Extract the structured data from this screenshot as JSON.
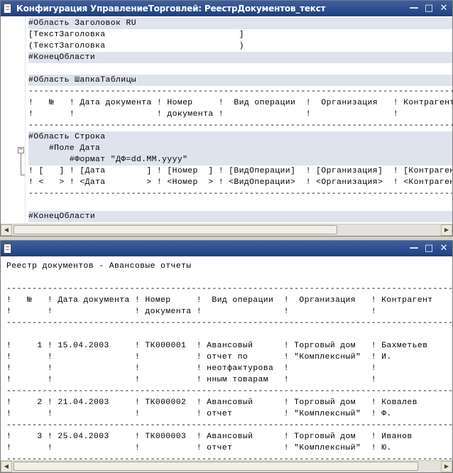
{
  "window1": {
    "title": "Конфигурация УправлениеТорговлей: РеестрДокументов_текст",
    "buttons": {
      "minimize": "—",
      "maximize": "□",
      "close": "✕"
    }
  },
  "window2": {
    "buttons": {
      "minimize": "—",
      "maximize": "□",
      "close": "✕"
    }
  },
  "template_lines": [
    {
      "text": "#Область Заголовок RU",
      "hl": true
    },
    {
      "text": "[ТекстЗаголовка                          ]",
      "hl": false
    },
    {
      "text": "(ТекстЗаголовка                          )",
      "hl": false
    },
    {
      "text": "#КонецОбласти",
      "hl": true
    },
    {
      "text": "",
      "hl": false
    },
    {
      "text": "#Область ШапкаТаблицы",
      "hl": true
    },
    {
      "text": "------------------------------------------------------------------------------------------",
      "hl": false
    },
    {
      "text": "!   №   ! Дата документа ! Номер     !  Вид операции  !  Организация   ! Контрагент",
      "hl": false
    },
    {
      "text": "!       !                ! документа !                !                !",
      "hl": false
    },
    {
      "text": "------------------------------------------------------------------------------------------",
      "hl": false
    },
    {
      "text": "#Область Строка",
      "hl": true
    },
    {
      "text": "    #Поле Дата",
      "hl": true
    },
    {
      "text": "        #Формат \"ДФ=dd.MM.yyyy\"",
      "hl": true
    },
    {
      "text": "! [   ] ! [Дата        ] ! [Номер  ] ! [ВидОперации]  ! [Организация]  ! [Контрагент]",
      "hl": false
    },
    {
      "text": "! <   > ! <Дата        > ! <Номер  > ! <ВидОперации>  ! <Организация>  ! <Контрагент>",
      "hl": false
    },
    {
      "text": "------------------------------------------------------------------------------------------",
      "hl": false
    },
    {
      "text": "",
      "hl": false
    },
    {
      "text": "#КонецОбласти",
      "hl": true
    }
  ],
  "report_lines": [
    "Реестр документов - Авансовые отчеты",
    "",
    "-------------------------------------------------------------------------------------------",
    "!   №   ! Дата документа ! Номер     !  Вид операции  !  Организация   ! Контрагент",
    "!       !                ! документа !                !                !",
    "-------------------------------------------------------------------------------------------",
    "",
    "!     1 ! 15.04.2003     ! ТК000001  ! Авансовый      ! Торговый дом   ! Бахметьев",
    "!       !                !           ! отчет по       ! \"Комплексный\"  ! И.",
    "!       !                !           ! неотфактурова  !                !",
    "!       !                !           ! нным товарам   !                !",
    "-------------------------------------------------------------------------------------------",
    "!     2 ! 21.04.2003     ! ТК000002  ! Авансовый      ! Торговый дом   ! Ковалев",
    "!       !                !           ! отчет          ! \"Комплексный\"  ! Ф.",
    "-------------------------------------------------------------------------------------------",
    "!     3 ! 25.04.2003     ! ТК000003  ! Авансовый      ! Торговый дом   ! Иванов",
    "!       !                !           ! отчет          ! \"Комплексный\"  ! Ю.",
    "-------------------------------------------------------------------------------------------"
  ],
  "colors": {
    "titlebar": "#1f3f7f",
    "region_highlight": "#dfe3ee",
    "keyword": "#1c2f9a"
  },
  "icons": {
    "document": "document-icon",
    "fold": "fold-minus-icon"
  }
}
